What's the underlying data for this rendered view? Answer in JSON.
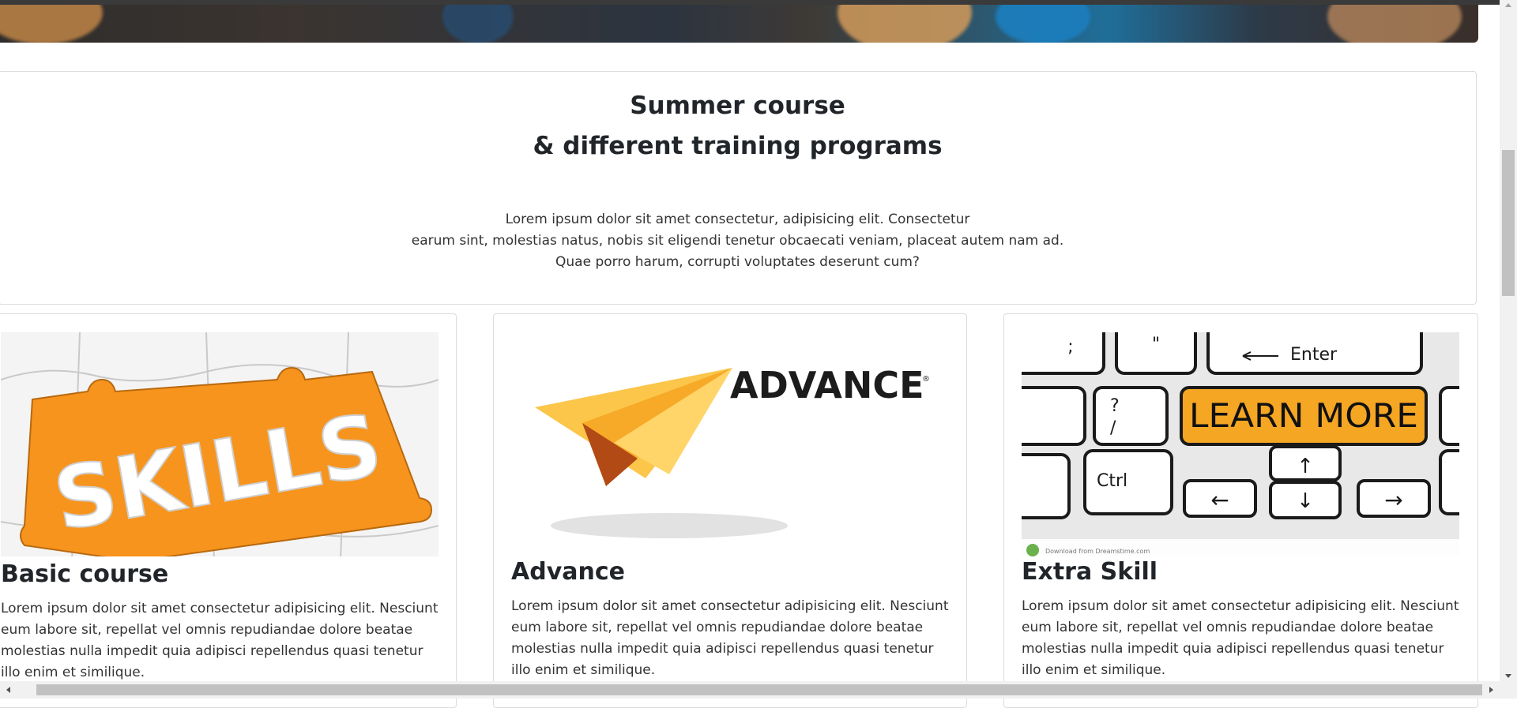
{
  "intro": {
    "title_line1": "Summer course",
    "title_line2": "& different training programs",
    "text_line1": "Lorem ipsum dolor sit amet consectetur, adipisicing elit. Consectetur",
    "text_line2": "earum sint, molestias natus, nobis sit eligendi tenetur obcaecati veniam, placeat autem nam ad.",
    "text_line3": "Quae porro harum, corrupti voluptates deserunt cum?"
  },
  "cards": [
    {
      "title": "Basic course",
      "text": "Lorem ipsum dolor sit amet consectetur adipisicing elit. Nesciunt eum labore sit, repellat vel omnis repudiandae dolore beatae molestias nulla impedit quia adipisci repellendus quasi tenetur illo enim et similique.",
      "image_word": "SKILLS",
      "image_icon": "puzzle-skills-image"
    },
    {
      "title": "Advance",
      "text": "Lorem ipsum dolor sit amet consectetur adipisicing elit. Nesciunt eum labore sit, repellat vel omnis repudiandae dolore beatae molestias nulla impedit quia adipisci repellendus quasi tenetur illo enim et similique.",
      "image_word": "ADVANCE",
      "image_mark": "®",
      "image_icon": "paper-plane-advance-logo"
    },
    {
      "title": "Extra Skill",
      "text": "Lorem ipsum dolor sit amet consectetur adipisicing elit. Nesciunt eum labore sit, repellat vel omnis repudiandae dolore beatae molestias nulla impedit quia adipisci repellendus quasi tenetur illo enim et similique.",
      "image_icon": "keyboard-learn-more-image",
      "keys": {
        "enter": "Enter",
        "learn_more": "LEARN MORE",
        "ctrl": "Ctrl",
        "quote": "\"",
        "semicolon": ";",
        "question": "?",
        "slash": "/",
        "up": "↑",
        "down": "↓",
        "left": "←",
        "right": "→"
      },
      "watermark": "Download from Dreamstime.com"
    }
  ],
  "colors": {
    "orange": "#f7941d",
    "learn_more_key": "#f5a623",
    "border": "#dcdcdc",
    "text": "#212529"
  }
}
